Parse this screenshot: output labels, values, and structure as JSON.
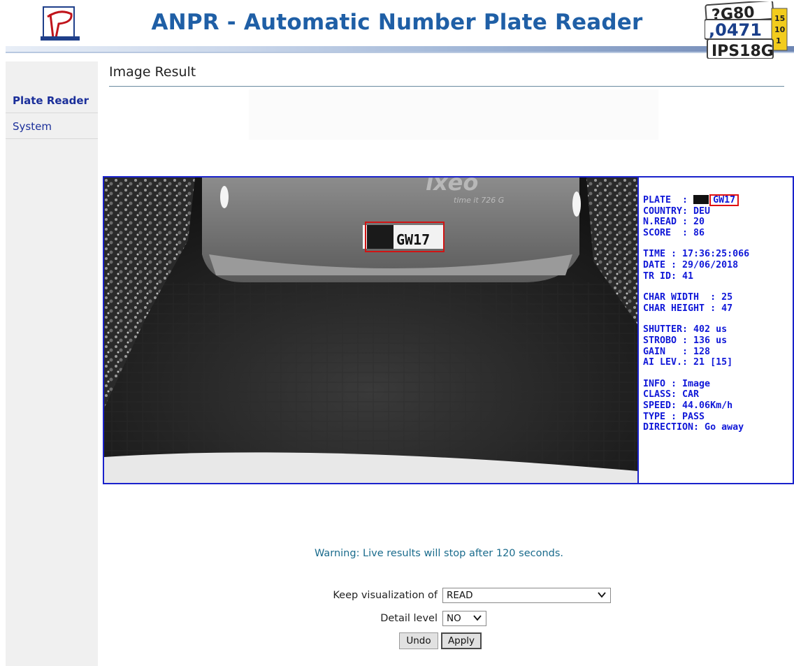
{
  "header": {
    "title_main": "ANPR",
    "title_rest": " - Automatic Number Plate Reader",
    "logo_icon": "p-logo-icon",
    "plates_icon": "license-plates-icon"
  },
  "sidebar": {
    "items": [
      {
        "label": "Plate Reader",
        "active": true
      },
      {
        "label": "System",
        "active": false
      }
    ]
  },
  "page": {
    "title": "Image Result"
  },
  "image": {
    "plate_text": "GW17",
    "overlay": {
      "plate_label": "PLATE  : ",
      "plate_value": "GW17",
      "country": "COUNTRY: DEU",
      "n_read": "N.READ : 20",
      "score": "SCORE  : 86",
      "time": "TIME : 17:36:25:066",
      "date": "DATE : 29/06/2018",
      "tr_id": "TR ID: 41",
      "char_width": "CHAR WIDTH  : 25",
      "char_height": "CHAR HEIGHT : 47",
      "shutter": "SHUTTER: 402 us",
      "strobo": "STROBO : 136 us",
      "gain": "GAIN   : 128",
      "ai_lev": "AI LEV.: 21 [15]",
      "info": "INFO : Image",
      "class": "CLASS: CAR",
      "speed": "SPEED: 44.06Km/h",
      "type": "TYPE : PASS",
      "direction": "DIRECTION: Go away"
    },
    "van_text": "ixeo",
    "van_subtext": "time it 726 G"
  },
  "warning": "Warning: Live results will stop after 120 seconds.",
  "form": {
    "keep_label": "Keep visualization of",
    "keep_value": "READ",
    "detail_label": "Detail level",
    "detail_value": "NO",
    "undo_label": "Undo",
    "apply_label": "Apply"
  },
  "colors": {
    "title_blue": "#1f5fa6",
    "frame_blue": "#1a22cc",
    "overlay_text": "#1018d8",
    "plate_box_red": "#e01010",
    "warning_text": "#1a6b8c"
  }
}
